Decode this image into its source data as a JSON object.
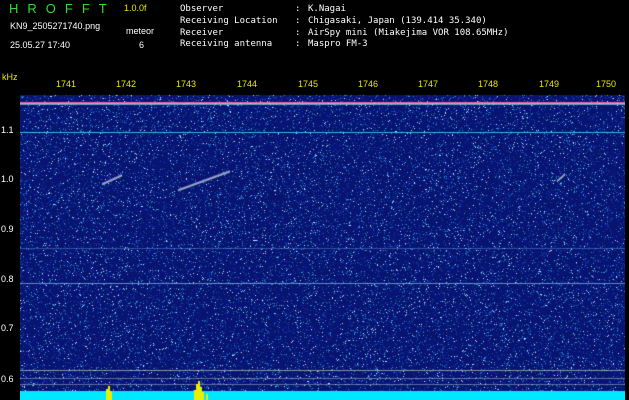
{
  "header": {
    "app_title": "HROFFT",
    "version": "1.0.0f",
    "file_name": "KN9_2505271740.png",
    "date_time": "25.05.27 17:40",
    "mode_label": "meteor",
    "mode_value": "6"
  },
  "station_info": [
    {
      "key": "Observer",
      "sep": ":",
      "value": "K.Nagai"
    },
    {
      "key": "Receiving Location",
      "sep": ":",
      "value": "Chigasaki, Japan (139.414 35.340)"
    },
    {
      "key": "Receiver",
      "sep": ":",
      "value": "AirSpy mini (Miakejima VOR 108.65MHz)"
    },
    {
      "key": "Receiving antenna",
      "sep": ":",
      "value": "Maspro FM-3"
    }
  ],
  "freq_axis": {
    "unit": "kHz",
    "ticks": [
      "1.1",
      "1.0",
      "0.9",
      "0.8",
      "0.7",
      "0.6"
    ],
    "tick_values": [
      1.1,
      1.0,
      0.9,
      0.8,
      0.7,
      0.6
    ]
  },
  "time_axis": {
    "ticks": [
      "1741",
      "1742",
      "1743",
      "1744",
      "1745",
      "1746",
      "1747",
      "1748",
      "1749",
      "1750"
    ]
  },
  "colors": {
    "title": "#38d838",
    "accent": "#e8e800",
    "text": "#ffffff",
    "background": "#000000",
    "spectrum_base": "#0a1a70",
    "signal": "#40e0e8",
    "spectrum_bar": "#00e8ff"
  }
}
